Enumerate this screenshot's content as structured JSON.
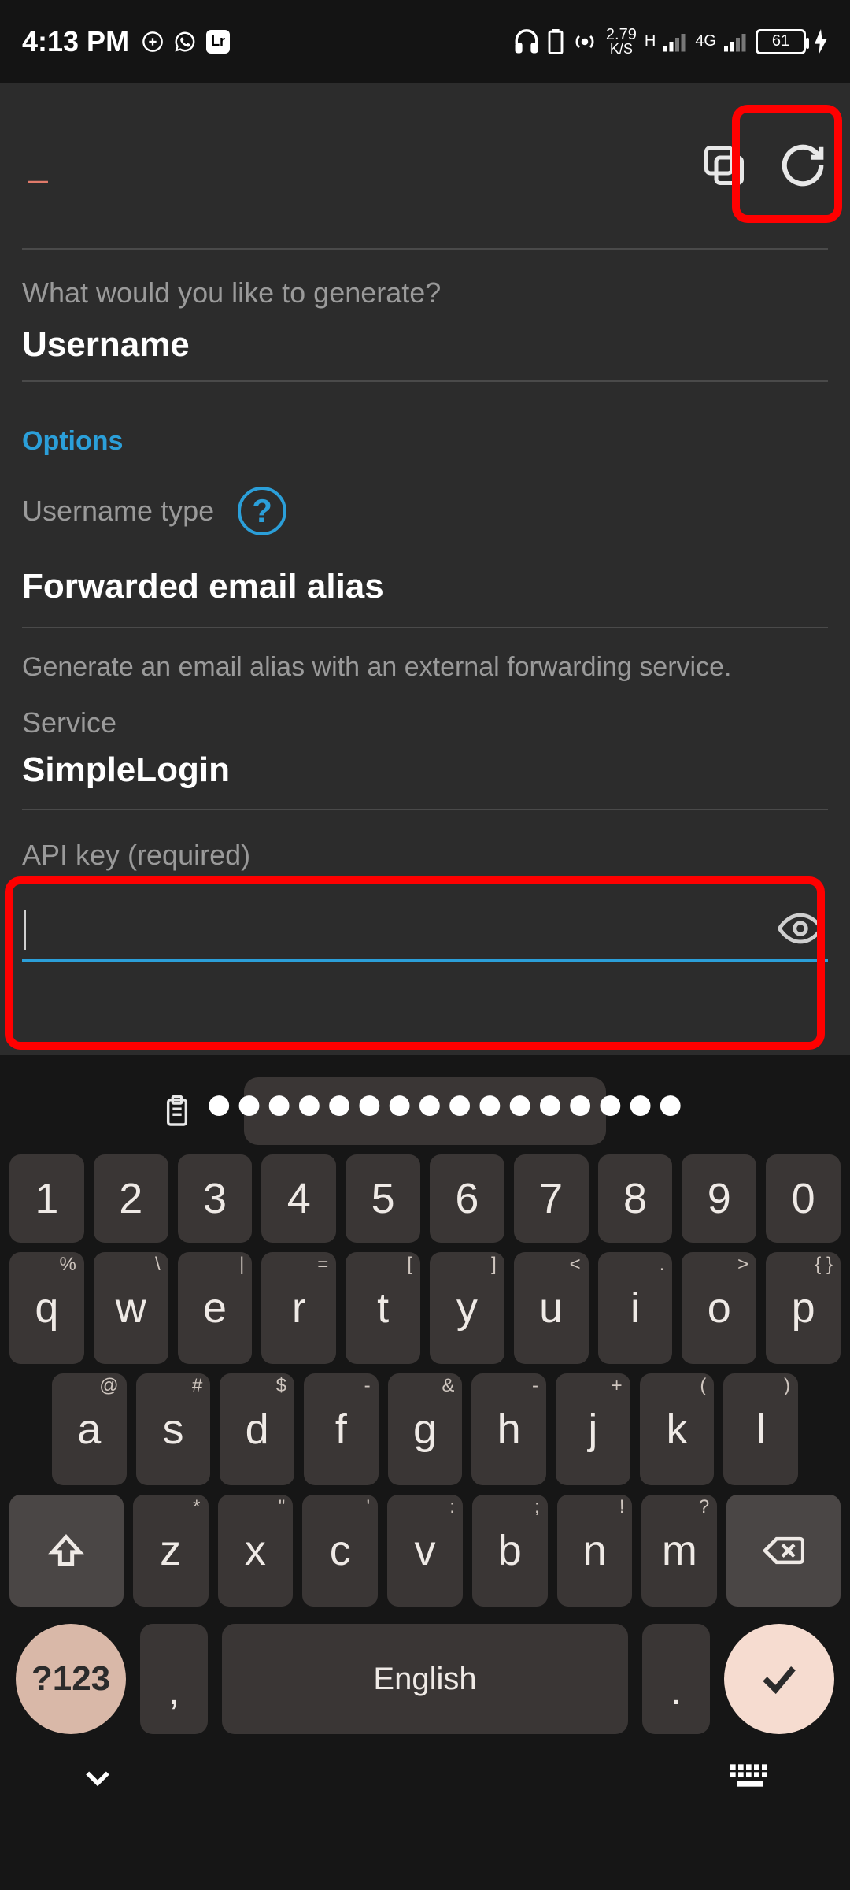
{
  "status": {
    "time": "4:13 PM",
    "lr_badge": "Lr",
    "kbps_top": "2.79",
    "kbps_bottom": "K/S",
    "net_left_label": "H",
    "net_right_label": "4G",
    "battery": "61"
  },
  "topbar": {
    "dash": "_"
  },
  "gen": {
    "prompt": "What would you like to generate?",
    "value": "Username"
  },
  "options": {
    "heading": "Options",
    "username_type_label": "Username type",
    "help_q": "?",
    "username_type_value": "Forwarded email alias",
    "description": "Generate an email alias with an external forwarding service.",
    "service_label": "Service",
    "service_value": "SimpleLogin",
    "api_key_label": "API key (required)",
    "api_key_value": ""
  },
  "clipboard": {
    "dots": "●●●●●●●●●●●●●●●●"
  },
  "keyboard": {
    "row1": [
      "1",
      "2",
      "3",
      "4",
      "5",
      "6",
      "7",
      "8",
      "9",
      "0"
    ],
    "row2": [
      {
        "k": "q",
        "s": "%"
      },
      {
        "k": "w",
        "s": "\\"
      },
      {
        "k": "e",
        "s": "|"
      },
      {
        "k": "r",
        "s": "="
      },
      {
        "k": "t",
        "s": "["
      },
      {
        "k": "y",
        "s": "]"
      },
      {
        "k": "u",
        "s": "<"
      },
      {
        "k": "i",
        "s": "."
      },
      {
        "k": "o",
        "s": ">"
      },
      {
        "k": "p",
        "s": "{   }"
      }
    ],
    "row3": [
      {
        "k": "a",
        "s": "@"
      },
      {
        "k": "s",
        "s": "#"
      },
      {
        "k": "d",
        "s": "$"
      },
      {
        "k": "f",
        "s": "-"
      },
      {
        "k": "g",
        "s": "&"
      },
      {
        "k": "h",
        "s": "-"
      },
      {
        "k": "j",
        "s": "+"
      },
      {
        "k": "k",
        "s": "("
      },
      {
        "k": "l",
        "s": ")"
      }
    ],
    "row4": [
      {
        "k": "z",
        "s": "*"
      },
      {
        "k": "x",
        "s": "\""
      },
      {
        "k": "c",
        "s": "'"
      },
      {
        "k": "v",
        "s": ":"
      },
      {
        "k": "b",
        "s": ";"
      },
      {
        "k": "n",
        "s": "!"
      },
      {
        "k": "m",
        "s": "?"
      }
    ],
    "sym": "?123",
    "comma": ",",
    "space": "English",
    "period": "."
  }
}
